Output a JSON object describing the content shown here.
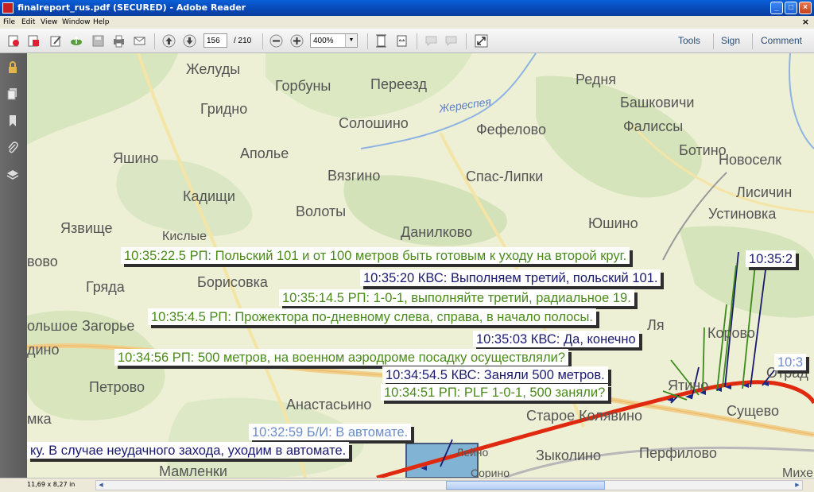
{
  "window": {
    "title": "finalreport_rus.pdf (SECURED) - Adobe Reader",
    "min": "_",
    "max": "□",
    "close": "×"
  },
  "menu": {
    "file": "File",
    "edit": "Edit",
    "view": "View",
    "window": "Window",
    "help": "Help",
    "close": "×"
  },
  "toolbar": {
    "page_current": "156",
    "page_total": "/ 210",
    "zoom": "400%",
    "tools": "Tools",
    "sign": "Sign",
    "comment": "Comment"
  },
  "status": {
    "page_size": "11,69 x 8,27 in"
  },
  "colors": {
    "flight_path": "#e02a10",
    "green_text": "#4a8a1a",
    "blue_text": "#1a1a70",
    "light_blue_text": "#6a8dc8",
    "map_bg": "#eef0d6"
  },
  "map": {
    "places": [
      "Желуды",
      "Горбуны",
      "Переезд",
      "Редня",
      "Жереспея",
      "Гридно",
      "Башковичи",
      "Солошино",
      "Фефелово",
      "Фалиссы",
      "Аполье",
      "Ботино",
      "Яшино",
      "Новоселк",
      "Вязгино",
      "Спас-Липки",
      "Кадищи",
      "Лисичин",
      "Волоты",
      "Устиновка",
      "Язвище",
      "Юшино",
      "Данилково",
      "Кислые",
      "вово",
      "Борисовка",
      "Гряда",
      "ольшое Загорье",
      "дино",
      "Петрово",
      "Анастасьино",
      "Старое Колявино",
      "Сущево",
      "Зыколино",
      "Перфилово",
      "Мамленки",
      "Михей",
      "Отрад",
      "мка",
      "Корово",
      "Ятино",
      "Ля",
      "Лейно",
      "Сорино"
    ]
  },
  "captions": {
    "c1": "10:35:22.5 РП: Польский 101 и от 100 метров быть готовым к уходу на второй круг.",
    "c1b": "10:35:2",
    "c2": "10:35:20 КВС: Выполняем третий, польский 101.",
    "c3": "10:35:14.5 РП: 1-0-1, выполняйте третий, радиальное 19.",
    "c4": "10:35:4.5 РП: Прожектора по-дневному слева, справа, в начало полосы.",
    "c5": "10:35:03 КВС: Да, конечно",
    "c6": "10:34:56 РП: 500 метров, на военном аэродроме посадку осуществляли?",
    "c6b": "10:3",
    "c7": "10:34:54.5 КВС: Заняли 500 метров.",
    "c8": "10:34:51 РП: PLF 1-0-1, 500 заняли?",
    "c9": "10:32:59 Б/И: В автомате.",
    "c10": "ку. В случае неудачного захода, уходим в автомате."
  }
}
